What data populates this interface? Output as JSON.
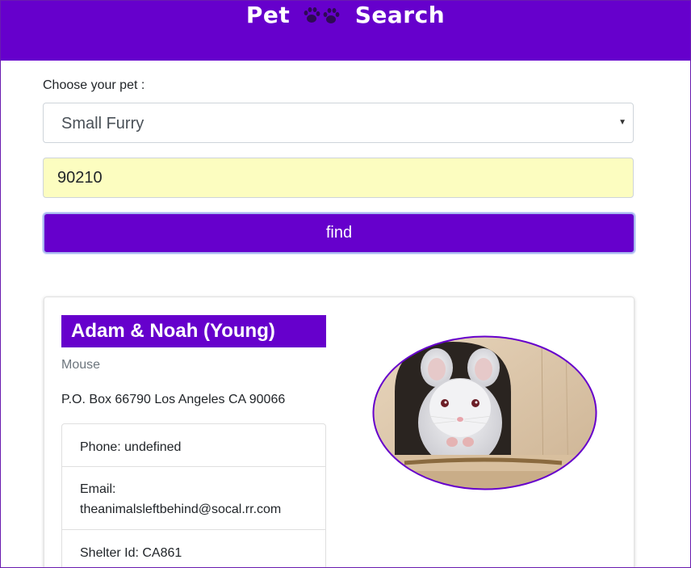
{
  "header": {
    "brand_left": "Pet",
    "brand_right": "Search",
    "brand_icon": "paw-prints-icon"
  },
  "search": {
    "choose_label": "Choose your pet :",
    "pet_type": "Small Furry",
    "zip_value": "90210",
    "find_label": "find"
  },
  "result": {
    "name": "Adam & Noah (Young)",
    "species": "Mouse",
    "address": "P.O. Box 66790 Los Angeles CA 90066",
    "phone": "Phone: undefined",
    "email_label": "Email:",
    "email": "theanimalsleftbehind@socal.rr.com",
    "shelter": "Shelter Id: CA861",
    "photo_icon": "mouse-photo"
  },
  "colors": {
    "brand": "#6600cc",
    "zip_background": "#fcfdc0"
  }
}
